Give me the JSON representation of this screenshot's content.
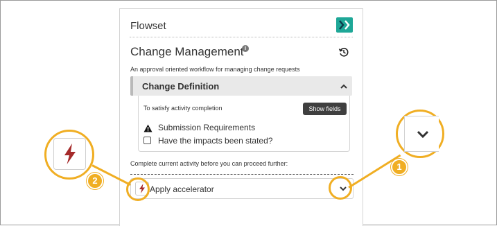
{
  "colors": {
    "accent": "#f0ae23",
    "logo": "#1ea797",
    "bolt": "#a52a2a",
    "button_dark": "#3f3f3f"
  },
  "panel": {
    "app_title": "Flowset",
    "logo_icon": "flowset-logo-icon",
    "process_title": "Change Management",
    "info_icon": "info-icon",
    "history_icon": "history-icon",
    "description": "An approval oriented workflow for managing change requests"
  },
  "activity": {
    "title": "Change Definition",
    "collapse_icon": "chevron-up-icon",
    "satisfy_text": "To satisfy activity completion",
    "show_fields_label": "Show fields",
    "requirements_label": "Submission Requirements",
    "checkbox_label": "Have the impacts been stated?",
    "checkbox_checked": false
  },
  "footer": {
    "complete_text": "Complete current activity before you can proceed further:",
    "accelerator_label": "Apply accelerator",
    "accelerator_icon": "lightning-bolt-icon",
    "accelerator_chevron": "chevron-down-icon"
  },
  "callouts": [
    {
      "number": "1",
      "target": "chevron-down-icon"
    },
    {
      "number": "2",
      "target": "lightning-bolt-icon"
    }
  ]
}
